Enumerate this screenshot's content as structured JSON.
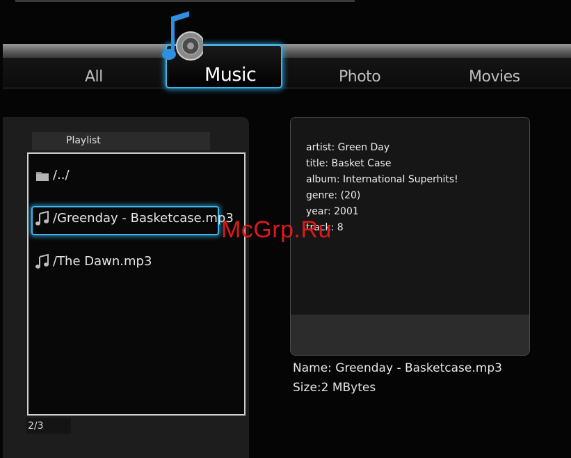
{
  "nav": {
    "tabs": [
      {
        "label": "All"
      },
      {
        "label": "Music",
        "selected": true
      },
      {
        "label": "Photo"
      },
      {
        "label": "Movies"
      }
    ]
  },
  "playlist": {
    "header": "Playlist",
    "items": [
      {
        "label": "/../",
        "icon": "folder-icon"
      },
      {
        "label": "/Greenday - Basketcase.mp3",
        "icon": "music-note-icon",
        "selected": true
      },
      {
        "label": "/The Dawn.mp3",
        "icon": "music-note-icon"
      }
    ],
    "page": "2/3"
  },
  "info": {
    "lines": [
      "artist: Green Day",
      "title: Basket Case",
      "album: International Superhits!",
      "genre: (20)",
      "year: 2001",
      "track: 8"
    ]
  },
  "details": {
    "name": "Name: Greenday - Basketcase.mp3",
    "size": "Size:2 MBytes"
  },
  "watermark": "McGrp.Ru",
  "colors": {
    "accent": "#3fb4e6",
    "watermark": "#e01818",
    "background": "#050505"
  }
}
